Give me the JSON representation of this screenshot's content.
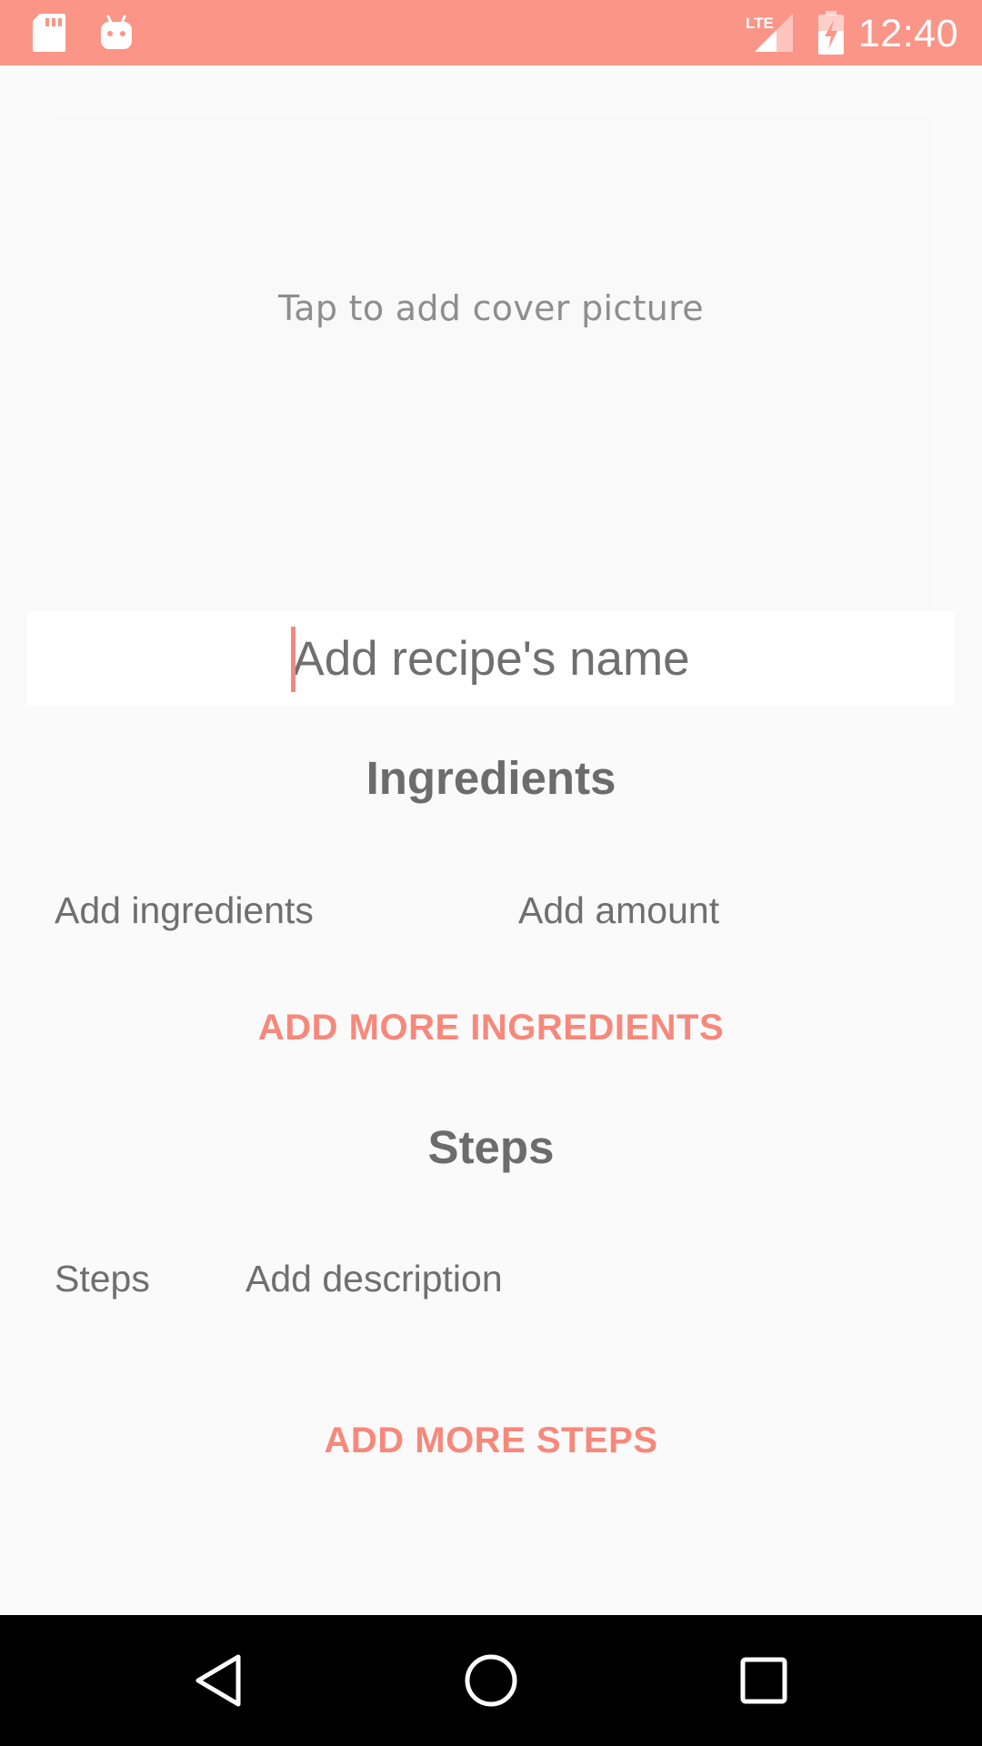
{
  "status_bar": {
    "time": "12:40",
    "network_label": "LTE",
    "icons": [
      "sd-card-icon",
      "android-debug-icon",
      "lte-signal-icon",
      "battery-charging-icon"
    ],
    "background_color": "#fb9587"
  },
  "cover": {
    "prompt": "Tap to add cover picture"
  },
  "recipe": {
    "name_placeholder": "Add recipe's name",
    "name_value": ""
  },
  "ingredients": {
    "title": "Ingredients",
    "name_placeholder": "Add ingredients",
    "amount_placeholder": "Add amount",
    "add_more_label": "ADD MORE INGREDIENTS"
  },
  "steps": {
    "title": "Steps",
    "step_label": "Steps",
    "description_placeholder": "Add description",
    "add_more_label": "ADD MORE STEPS"
  },
  "nav_bar": {
    "icons": [
      "back-icon",
      "home-icon",
      "recents-icon"
    ]
  },
  "colors": {
    "accent": "#f6897b",
    "text": "#6f6f6f",
    "background": "#fafafa"
  }
}
